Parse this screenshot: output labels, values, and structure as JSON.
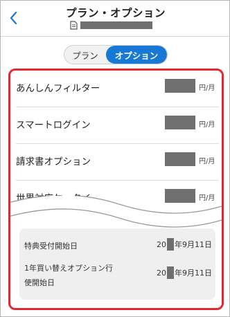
{
  "header": {
    "title": "プラン・オプション"
  },
  "tabs": {
    "plan": "プラン",
    "option": "オプション",
    "selected": "option"
  },
  "options": [
    {
      "name": "あんしんフィルター",
      "unit": "円/月"
    },
    {
      "name": "スマートログイン",
      "unit": "円/月"
    },
    {
      "name": "請求書オプション",
      "unit": "円/月"
    },
    {
      "name": "世界対応ケータイ",
      "unit": "円/月"
    }
  ],
  "dates": {
    "special_start_label": "特典受付開始日",
    "special_start_prefix": "20",
    "special_start_suffix": "年9月11日",
    "replace_option_label_line1": "1年買い替えオプション行",
    "replace_option_label_line2": "使開始日",
    "replace_option_prefix": "20",
    "replace_option_suffix": "年9月11日"
  },
  "colors": {
    "accent": "#1778d6",
    "highlight_border": "#e3282e",
    "redaction": "#6f6f6f"
  }
}
